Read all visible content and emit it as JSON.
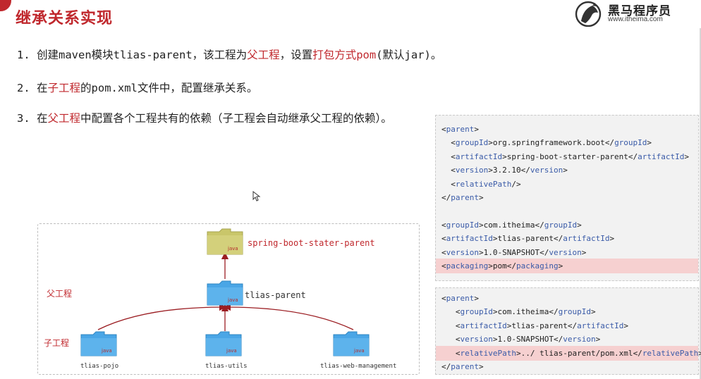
{
  "header": {
    "title": "继承关系实现",
    "logo_name": "黑马程序员",
    "logo_url": "www.itheima.com"
  },
  "steps": [
    {
      "num": "1.",
      "t1": "创建maven模块tlias-parent，该工程为",
      "e1": "父工程",
      "t2": "，设置",
      "e2": "打包方式pom",
      "t3": "(默认jar)。"
    },
    {
      "num": "2.",
      "t1": "在",
      "e1": "子工程",
      "t2": "的pom.xml文件中，配置继承关系。"
    },
    {
      "num": "3.",
      "t1": "在",
      "e1": "父工程",
      "t2": "中配置各个工程共有的依赖（子工程会自动继承父工程的依赖）。"
    }
  ],
  "parent_pom": {
    "lines": [
      [
        "",
        "<",
        "parent",
        ">",
        "",
        "",
        "",
        ""
      ],
      [
        "  ",
        "<",
        "groupId",
        ">",
        "org.springframework.boot",
        "</",
        "groupId",
        ">"
      ],
      [
        "  ",
        "<",
        "artifactId",
        ">",
        "spring-boot-starter-parent",
        "</",
        "artifactId",
        ">"
      ],
      [
        "  ",
        "<",
        "version",
        ">",
        "3.2.10",
        "</",
        "version",
        ">"
      ],
      [
        "  ",
        "<",
        "relativePath",
        "/>",
        "",
        "",
        "",
        ""
      ],
      [
        "",
        "</",
        "parent",
        ">",
        "",
        "",
        "",
        ""
      ],
      [
        "",
        "",
        "",
        "",
        "",
        "",
        "",
        ""
      ],
      [
        "",
        "<",
        "groupId",
        ">",
        "com.itheima",
        "</",
        "groupId",
        ">"
      ],
      [
        "",
        "<",
        "artifactId",
        ">",
        "tlias-parent",
        "</",
        "artifactId",
        ">"
      ],
      [
        "",
        "<",
        "version",
        ">",
        "1.0-SNAPSHOT",
        "</",
        "version",
        ">"
      ],
      [
        "",
        "<",
        "packaging",
        ">",
        "pom",
        "</",
        "packaging",
        ">"
      ]
    ],
    "highlight_index": 10
  },
  "child_pom": {
    "lines": [
      [
        "",
        "<",
        "parent",
        ">",
        "",
        "",
        "",
        ""
      ],
      [
        "   ",
        "<",
        "groupId",
        ">",
        "com.itheima",
        "</",
        "groupId",
        ">"
      ],
      [
        "   ",
        "<",
        "artifactId",
        ">",
        "tlias-parent",
        "</",
        "artifactId",
        ">"
      ],
      [
        "   ",
        "<",
        "version",
        ">",
        "1.0-SNAPSHOT",
        "</",
        "version",
        ">"
      ],
      [
        "   ",
        "<",
        "relativePath",
        ">",
        "../ tlias-parent/pom.xml",
        "</",
        "relativePath",
        ">"
      ],
      [
        "",
        "</",
        "parent",
        ">",
        "",
        "",
        "",
        ""
      ]
    ],
    "highlight_index": 4
  },
  "diagram": {
    "top_node": "spring-boot-stater-parent",
    "parent_node": "tlias-parent",
    "children": [
      "tlias-pojo",
      "tlias-utils",
      "tlias-web-management"
    ],
    "parent_label": "父工程",
    "child_label": "子工程",
    "icon_caption": "java",
    "colors": {
      "accent": "#c0282d",
      "folder_top": "#c9c66a",
      "folder_blue": "#4aa6e6"
    }
  }
}
